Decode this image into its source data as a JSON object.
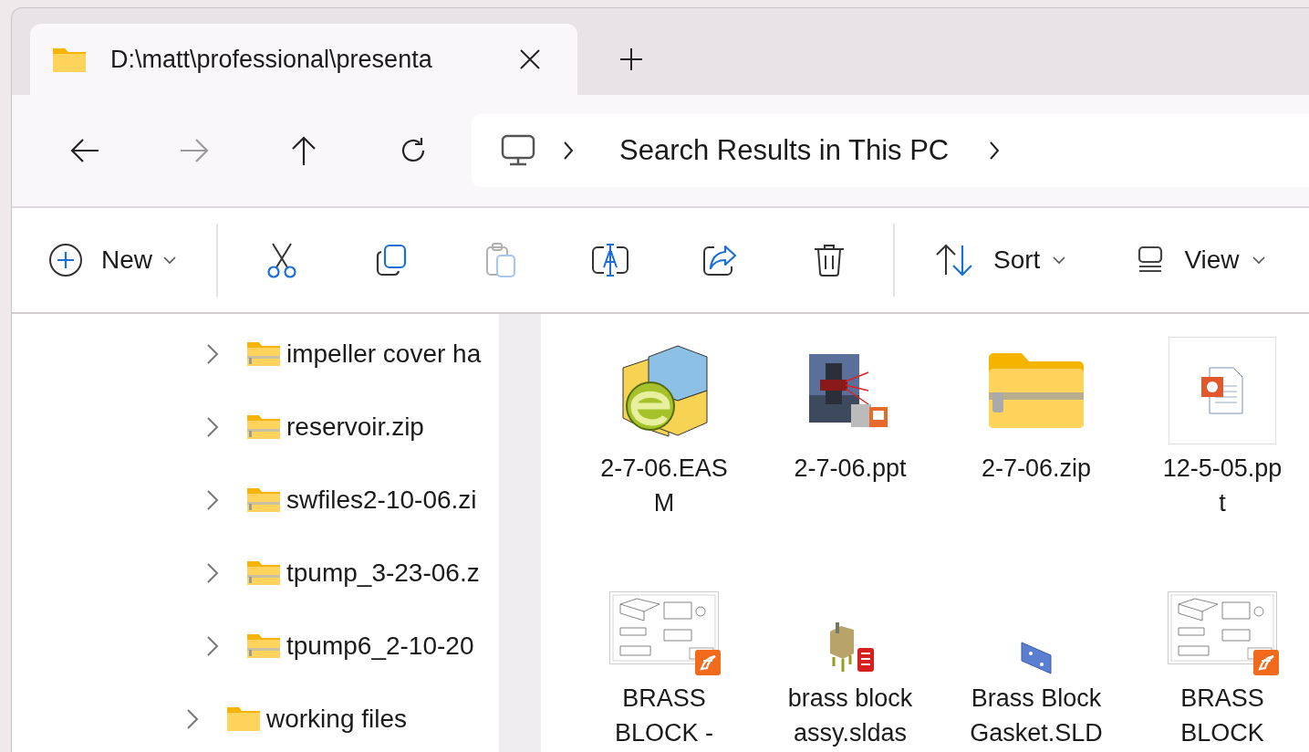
{
  "tabs": [
    {
      "title": "D:\\matt\\professional\\presenta",
      "selected": true
    }
  ],
  "nav": {
    "back": {
      "disabled": false
    },
    "forward": {
      "disabled": true
    },
    "up": {
      "disabled": false
    },
    "refresh": {
      "disabled": false
    }
  },
  "address": {
    "segments": [
      "Search Results in This PC"
    ]
  },
  "toolbar": [
    {
      "kind": "new",
      "label": "New",
      "disabled": false
    },
    {
      "kind": "cut",
      "disabled": false
    },
    {
      "kind": "copy",
      "disabled": false
    },
    {
      "kind": "paste",
      "disabled": true
    },
    {
      "kind": "rename",
      "disabled": false
    },
    {
      "kind": "share",
      "disabled": false
    },
    {
      "kind": "delete",
      "disabled": false
    },
    {
      "kind": "sort",
      "label": "Sort",
      "disabled": false
    },
    {
      "kind": "view",
      "label": "View",
      "disabled": false
    }
  ],
  "tree": [
    {
      "children": [
        {
          "label": "impeller cover ha",
          "kind": "zip",
          "expanded": false
        },
        {
          "label": "reservoir.zip",
          "kind": "zip",
          "expanded": false
        },
        {
          "label": "swfiles2-10-06.zi",
          "kind": "zip",
          "expanded": false
        },
        {
          "label": "tpump_3-23-06.z",
          "kind": "zip",
          "expanded": false
        },
        {
          "label": "tpump6_2-10-20",
          "kind": "zip",
          "expanded": false
        }
      ]
    },
    {
      "label": "working files",
      "kind": "folder",
      "expanded": false
    }
  ],
  "files": [
    {
      "kind": "easm",
      "lines": [
        "2-7-06.EAS",
        "M"
      ]
    },
    {
      "kind": "ppt-thumb",
      "lines": [
        "2-7-06.ppt"
      ]
    },
    {
      "kind": "zip",
      "lines": [
        "2-7-06.zip"
      ]
    },
    {
      "kind": "ppt",
      "lines": [
        "12-5-05.pp",
        "t"
      ]
    },
    {
      "kind": "drawing",
      "lines": [
        "BRASS",
        "BLOCK -"
      ]
    },
    {
      "kind": "assembly",
      "lines": [
        "brass block",
        "assy.sldas"
      ]
    },
    {
      "kind": "part",
      "lines": [
        "Brass Block",
        "Gasket.SLD"
      ]
    },
    {
      "kind": "drawing",
      "lines": [
        "BRASS",
        "BLOCK"
      ]
    }
  ]
}
